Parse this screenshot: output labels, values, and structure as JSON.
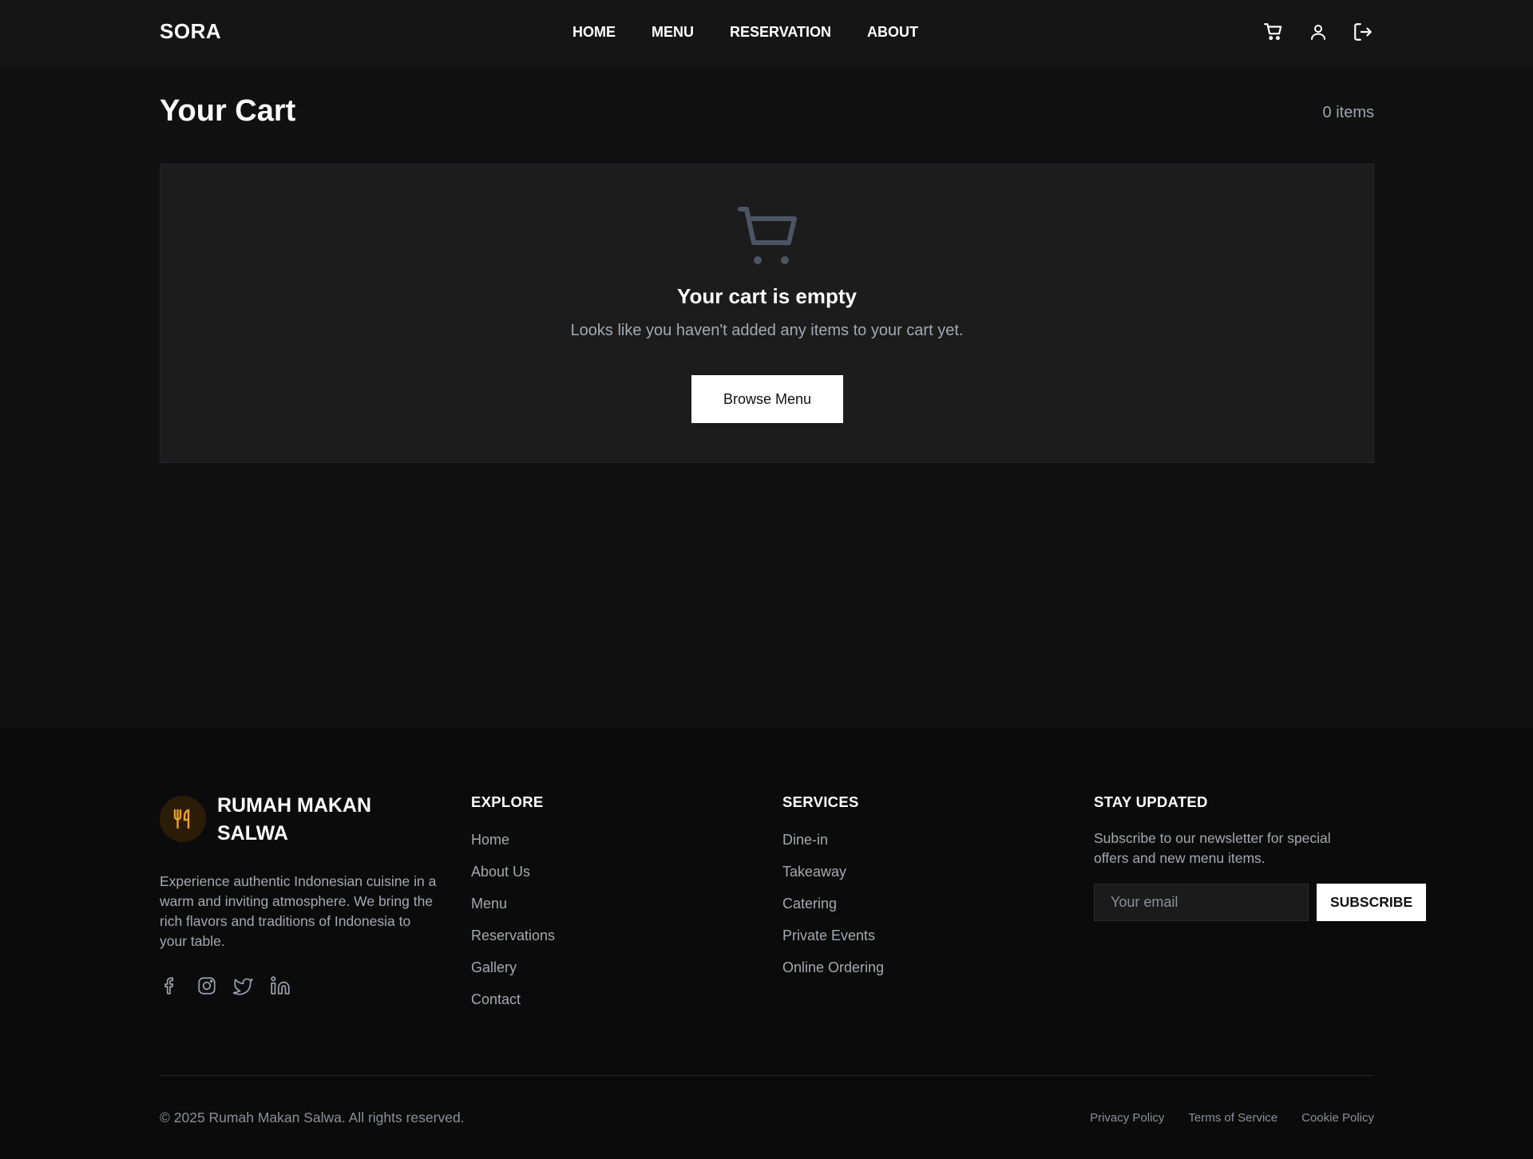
{
  "header": {
    "logo": "SORA",
    "nav": [
      "HOME",
      "MENU",
      "RESERVATION",
      "ABOUT"
    ],
    "icons": [
      "cart-icon",
      "user-icon",
      "logout-icon"
    ]
  },
  "cart": {
    "title": "Your Cart",
    "count": "0 items",
    "empty_title": "Your cart is empty",
    "empty_subtitle": "Looks like you haven't added any items to your cart yet.",
    "browse_button": "Browse Menu"
  },
  "footer": {
    "brand_name": "RUMAH MAKAN SALWA",
    "brand_desc": "Experience authentic Indonesian cuisine in a warm and inviting atmosphere. We bring the rich flavors and traditions of Indonesia to your table.",
    "socials": [
      "facebook-icon",
      "instagram-icon",
      "twitter-icon",
      "linkedin-icon"
    ],
    "explore": {
      "title": "EXPLORE",
      "items": [
        "Home",
        "About Us",
        "Menu",
        "Reservations",
        "Gallery",
        "Contact"
      ]
    },
    "services": {
      "title": "SERVICES",
      "items": [
        "Dine-in",
        "Takeaway",
        "Catering",
        "Private Events",
        "Online Ordering"
      ]
    },
    "newsletter": {
      "title": "STAY UPDATED",
      "desc": "Subscribe to our newsletter for special offers and new menu items.",
      "placeholder": "Your email",
      "button": "SUBSCRIBE"
    },
    "copyright": "© 2025 Rumah Makan Salwa. All rights reserved.",
    "legal": [
      "Privacy Policy",
      "Terms of Service",
      "Cookie Policy"
    ]
  },
  "colors": {
    "background": "#111112",
    "header_bg": "#151515",
    "footer_bg": "#0b0b0b",
    "card_bg": "#1c1c1d",
    "muted_text": "#a4a8b0",
    "brand_accent": "#e9a125"
  }
}
